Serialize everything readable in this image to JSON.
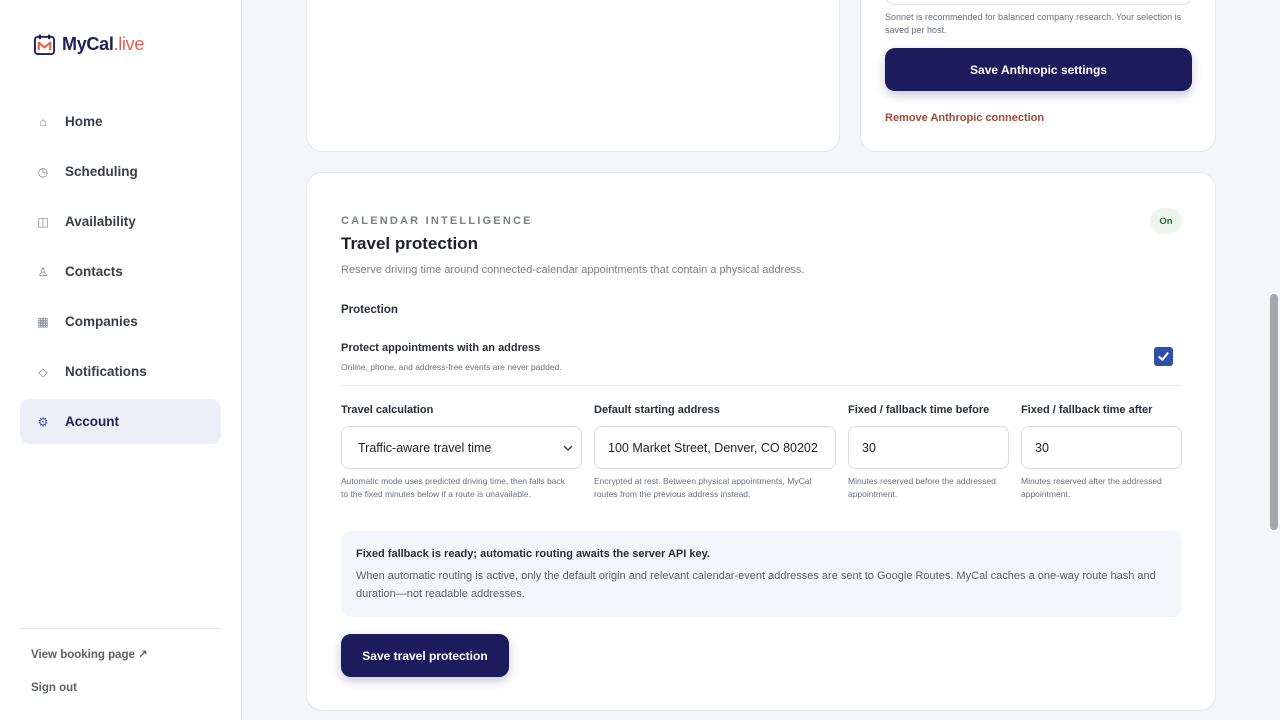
{
  "brand": {
    "name_main": "MyCal",
    "name_accent": ".live"
  },
  "sidebar": {
    "items": [
      {
        "label": "Home",
        "icon": "home-icon",
        "glyph": "⌂"
      },
      {
        "label": "Scheduling",
        "icon": "clock-icon",
        "glyph": "◷"
      },
      {
        "label": "Availability",
        "icon": "calendar-icon",
        "glyph": "◫"
      },
      {
        "label": "Contacts",
        "icon": "person-icon",
        "glyph": "♙"
      },
      {
        "label": "Companies",
        "icon": "building-icon",
        "glyph": "▦"
      },
      {
        "label": "Notifications",
        "icon": "bell-icon",
        "glyph": "◇"
      },
      {
        "label": "Account",
        "icon": "gear-icon",
        "glyph": "⚙",
        "active": true
      }
    ],
    "view_booking": "View booking page ↗",
    "sign_out": "Sign out"
  },
  "anthropic": {
    "model_hint": "Sonnet is recommended for balanced company research. Your selection is saved per host.",
    "save_label": "Save Anthropic settings",
    "remove_label": "Remove Anthropic connection"
  },
  "travel": {
    "eyebrow": "CALENDAR INTELLIGENCE",
    "badge": "On",
    "title": "Travel protection",
    "subtitle": "Reserve driving time around connected-calendar appointments that contain a physical address.",
    "section_label": "Protection",
    "protect": {
      "label": "Protect appointments with an address",
      "hint": "Online, phone, and address-free events are never padded.",
      "checked": true
    },
    "fields": {
      "calc": {
        "label": "Travel calculation",
        "value": "Traffic-aware travel time",
        "hint": "Automatic mode uses predicted driving time, then falls back to the fixed minutes below if a route is unavailable."
      },
      "address": {
        "label": "Default starting address",
        "value": "100 Market Street, Denver, CO 80202",
        "hint": "Encrypted at rest. Between physical appointments, MyCal routes from the previous address instead."
      },
      "before": {
        "label": "Fixed / fallback time before",
        "value": "30",
        "hint": "Minutes reserved before the addressed appointment."
      },
      "after": {
        "label": "Fixed / fallback time after",
        "value": "30",
        "hint": "Minutes reserved after the addressed appointment."
      }
    },
    "info": {
      "title": "Fixed fallback is ready; automatic routing awaits the server API key.",
      "body": "When automatic routing is active, only the default origin and relevant calendar-event addresses are sent to Google Routes. MyCal caches a one-way route hash and duration—not readable addresses."
    },
    "save_label": "Save travel protection"
  },
  "colors": {
    "primary": "#1c1c5c",
    "accent": "#e2624f",
    "danger_link": "#a04a3a",
    "checkbox": "#2f4fa8"
  }
}
